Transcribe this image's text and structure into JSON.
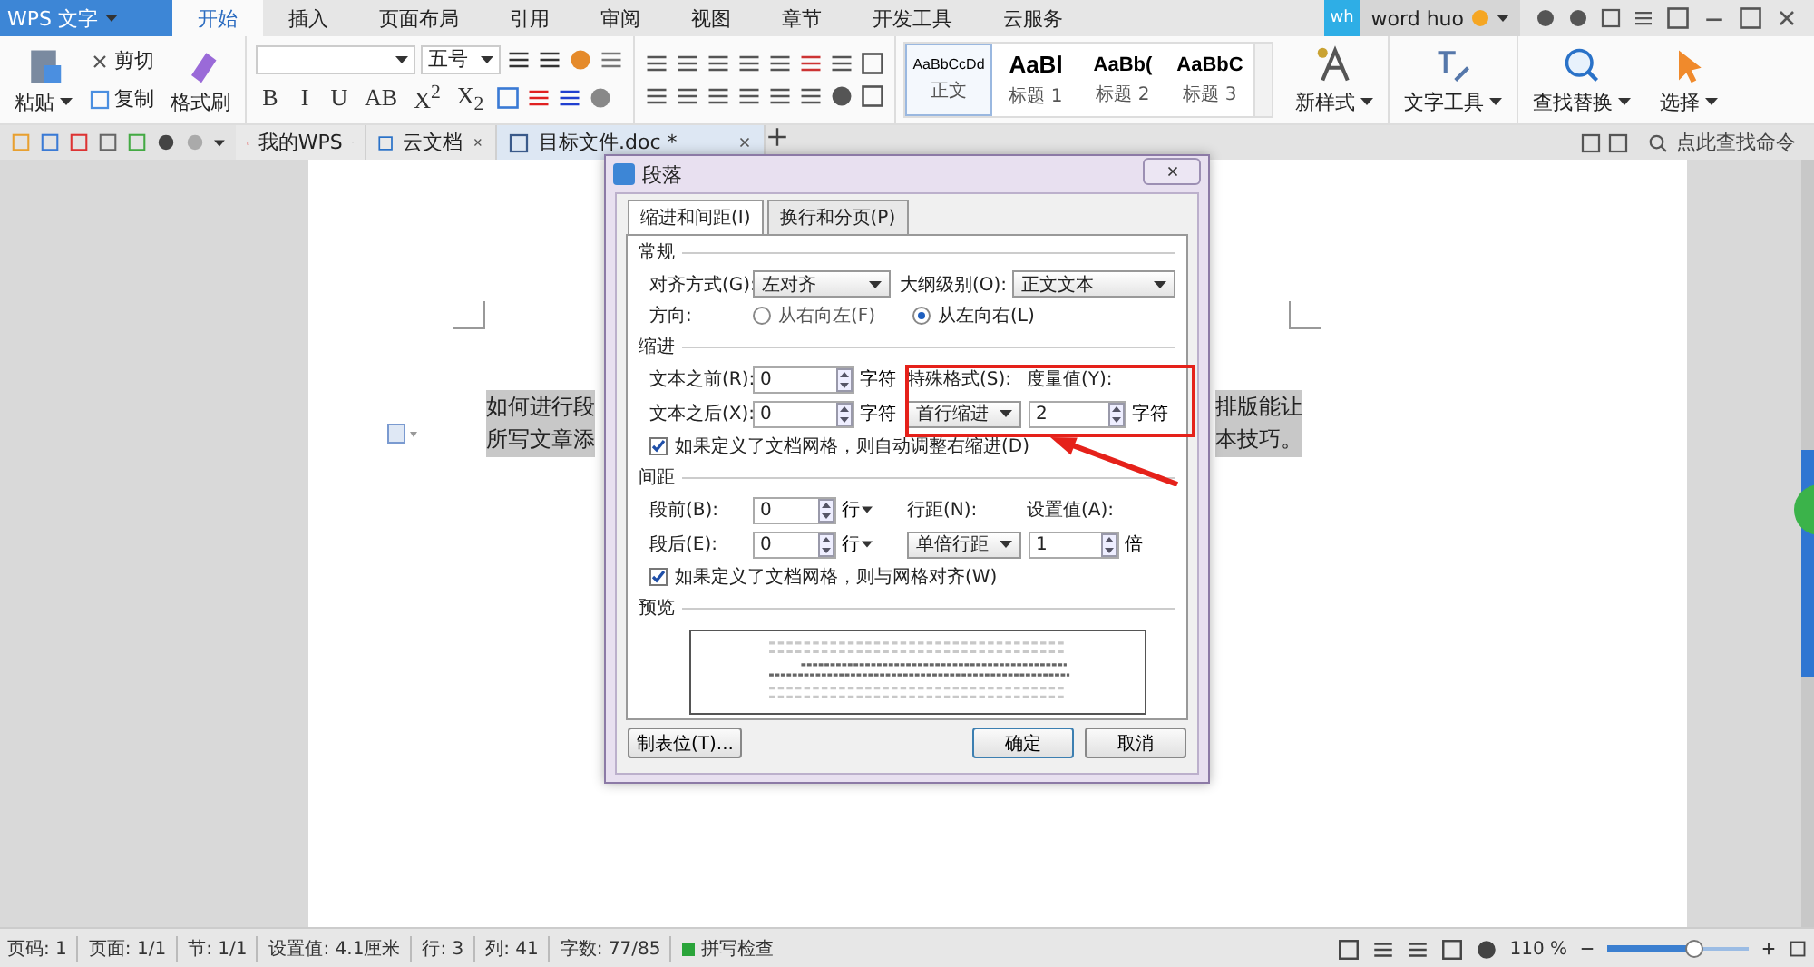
{
  "app_button": {
    "label": "WPS 文字"
  },
  "menu_tabs": [
    {
      "label": "开始",
      "selected": true
    },
    {
      "label": "插入",
      "selected": false
    },
    {
      "label": "页面布局",
      "selected": false
    },
    {
      "label": "引用",
      "selected": false
    },
    {
      "label": "审阅",
      "selected": false
    },
    {
      "label": "视图",
      "selected": false
    },
    {
      "label": "章节",
      "selected": false
    },
    {
      "label": "开发工具",
      "selected": false
    },
    {
      "label": "云服务",
      "selected": false
    }
  ],
  "account": {
    "avatar": "wh",
    "name": "word huo"
  },
  "ribbon": {
    "clipboard": {
      "paste": "粘贴",
      "cut": "剪切",
      "copy": "复制",
      "painter": "格式刷"
    },
    "font_size": "五号",
    "format_buttons": [
      "B",
      "I",
      "U",
      "AB",
      "X$^{2}$",
      "X$_{2}$"
    ],
    "styles": [
      {
        "preview": "AaBbCcDd",
        "label": "正文",
        "selected": true
      },
      {
        "preview": "AaBl",
        "label": "标题 1",
        "selected": false
      },
      {
        "preview": "AaBb(",
        "label": "标题 2",
        "selected": false
      },
      {
        "preview": "AaBbC",
        "label": "标题 3",
        "selected": false
      }
    ],
    "tools": [
      "新样式",
      "文字工具",
      "查找替换",
      "选择"
    ]
  },
  "doc_tabs": [
    {
      "label": "我的WPS",
      "selected": false
    },
    {
      "label": "云文档",
      "selected": false
    },
    {
      "label": "目标文件.doc *",
      "selected": true
    }
  ],
  "command_search": {
    "placeholder": "点此查找命令"
  },
  "document": {
    "lines": [
      {
        "left": "如何进行段",
        "right": "排版能让"
      },
      {
        "left": "所写文章添",
        "right": "本技巧。"
      }
    ]
  },
  "dialog": {
    "title": "段落",
    "tabs": [
      {
        "label": "缩进和间距(I)",
        "selected": true
      },
      {
        "label": "换行和分页(P)",
        "selected": false
      }
    ],
    "general": {
      "heading": "常规",
      "alignment": {
        "label": "对齐方式(G):",
        "value": "左对齐"
      },
      "outline": {
        "label": "大纲级别(O):",
        "value": "正文文本"
      },
      "direction": {
        "label": "方向:",
        "options": [
          {
            "label": "从右向左(F)",
            "selected": false
          },
          {
            "label": "从左向右(L)",
            "selected": true
          }
        ]
      }
    },
    "indent": {
      "heading": "缩进",
      "before": {
        "label": "文本之前(R):",
        "value": "0",
        "unit": "字符"
      },
      "after": {
        "label": "文本之后(X):",
        "value": "0",
        "unit": "字符"
      },
      "special": {
        "label": "特殊格式(S):",
        "value": "首行缩进"
      },
      "measure": {
        "label": "度量值(Y):",
        "value": "2",
        "unit": "字符"
      },
      "grid_checkbox": {
        "label": "如果定义了文档网格，则自动调整右缩进(D)",
        "checked": true
      }
    },
    "spacing": {
      "heading": "间距",
      "before": {
        "label": "段前(B):",
        "value": "0",
        "unit": "行"
      },
      "after": {
        "label": "段后(E):",
        "value": "0",
        "unit": "行"
      },
      "line_spacing": {
        "label": "行距(N):",
        "value": "单倍行距"
      },
      "set_value": {
        "label": "设置值(A):",
        "value": "1",
        "unit": "倍"
      },
      "grid_checkbox": {
        "label": "如果定义了文档网格，则与网格对齐(W)",
        "checked": true
      }
    },
    "preview": {
      "heading": "预览"
    },
    "buttons": {
      "tabs": "制表位(T)...",
      "ok": "确定",
      "cancel": "取消"
    }
  },
  "status_bar": {
    "items": [
      "页码: 1",
      "页面: 1/1",
      "节: 1/1",
      "设置值: 4.1厘米",
      "行: 3",
      "列: 41",
      "字数: 77/85"
    ],
    "spell_check": "拼写检查",
    "zoom": "110 %",
    "zoom_slider": {
      "level": 0.62
    }
  }
}
